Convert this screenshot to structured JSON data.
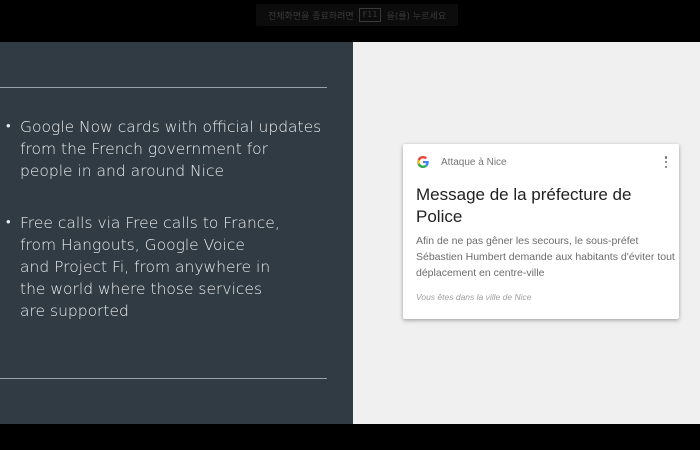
{
  "fullscreen_hint": {
    "prefix": "전체화면을 종료하려면",
    "key": "F11",
    "suffix": "을(를) 누르세요"
  },
  "slide": {
    "bullets": [
      {
        "marker": "•",
        "lines": [
          "Google Now cards with official updates",
          "from the French government for",
          "people in and around Nice"
        ]
      },
      {
        "marker": "•",
        "lines": [
          "Free calls via Free calls to France,",
          "from Hangouts, Google Voice",
          "and Project Fi, from anywhere in",
          "the world where those services",
          "are supported"
        ]
      }
    ]
  },
  "card": {
    "logo_icon": "google-g-icon",
    "source": "Attaque à Nice",
    "menu_icon": "more-vert-icon",
    "title": "Message de la préfecture de Police",
    "body": "Afin de ne pas gêner les secours, le sous-préfet Sébastien Humbert demande aux habitants d'éviter tout déplacement en centre-ville",
    "footer": "Vous êtes dans la ville de Nice"
  },
  "colors": {
    "slide_dark": "#303b43",
    "slide_light": "#f0f0f0",
    "google_blue": "#4285F4",
    "google_red": "#EA4335",
    "google_yellow": "#FBBC05",
    "google_green": "#34A853"
  }
}
